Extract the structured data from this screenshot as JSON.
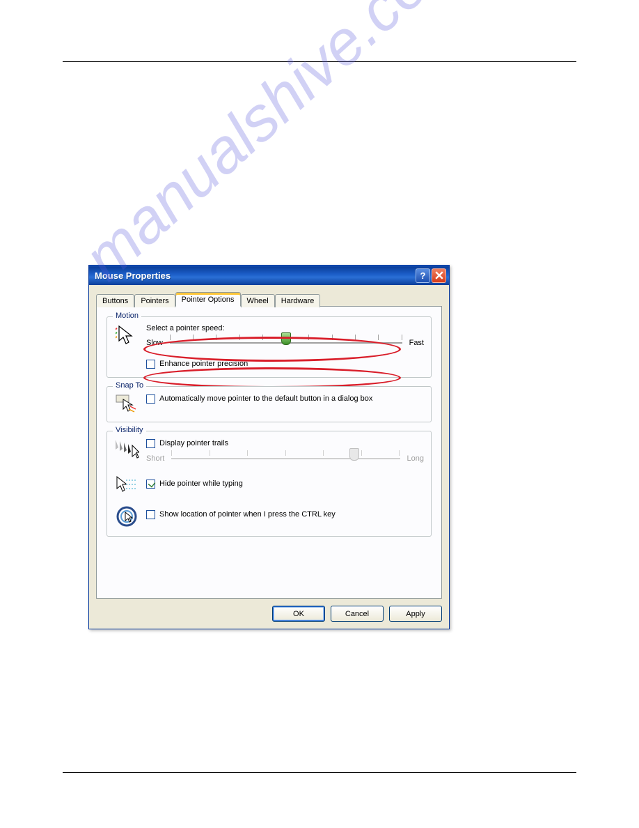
{
  "window": {
    "title": "Mouse Properties"
  },
  "tabs": {
    "buttons": "Buttons",
    "pointers": "Pointers",
    "pointer_options": "Pointer Options",
    "wheel": "Wheel",
    "hardware": "Hardware"
  },
  "motion": {
    "legend": "Motion",
    "label": "Select a pointer speed:",
    "slow": "Slow",
    "fast": "Fast",
    "enhance": "Enhance pointer precision"
  },
  "snapto": {
    "legend": "Snap To",
    "label": "Automatically move pointer to the default button in a dialog box"
  },
  "visibility": {
    "legend": "Visibility",
    "trails": "Display pointer trails",
    "short": "Short",
    "long": "Long",
    "hide": "Hide pointer while typing",
    "ctrl": "Show location of pointer when I press the CTRL key"
  },
  "buttons": {
    "ok": "OK",
    "cancel": "Cancel",
    "apply": "Apply"
  },
  "watermark": "manualshive.com"
}
